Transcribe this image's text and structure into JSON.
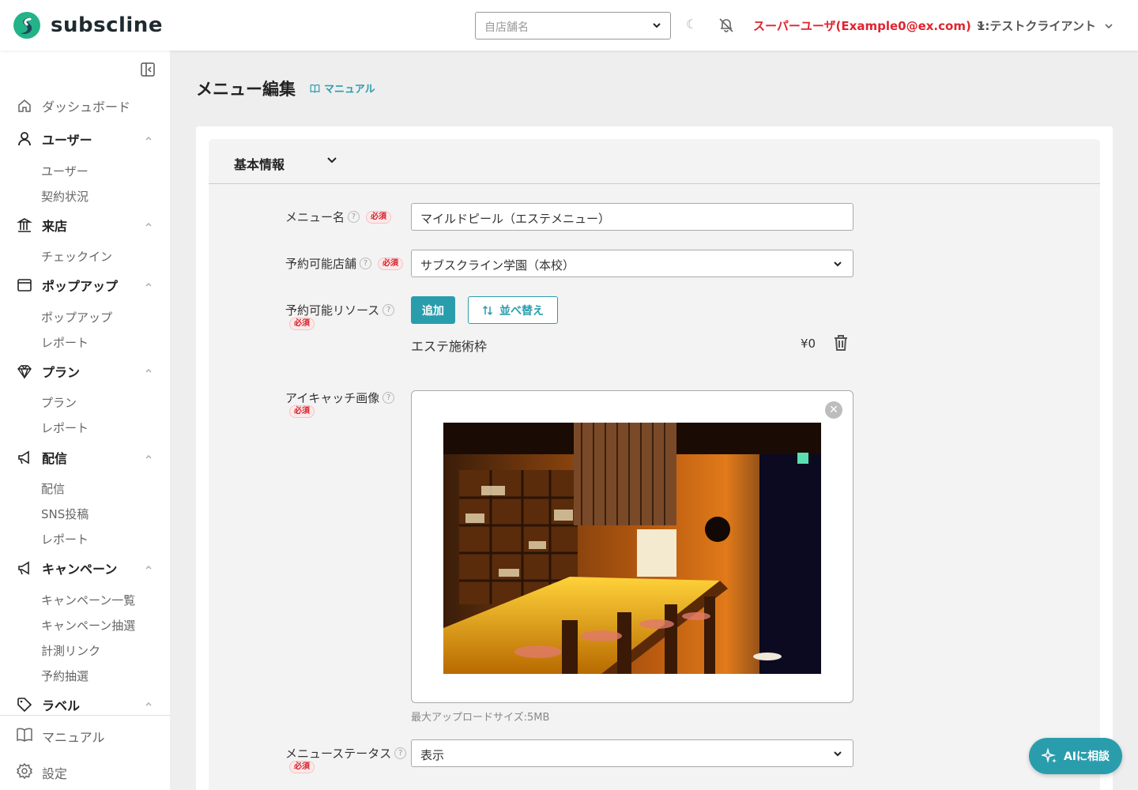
{
  "app": {
    "brand": "subscline",
    "accent": "#2a9dad",
    "alert": "#e0242f"
  },
  "header": {
    "store_placeholder": "自店舗名",
    "user_label": "スーパーユーザ(Example0@ex.com)",
    "client_label": "1:テストクライアント",
    "theme_icon": "moon-icon",
    "notify_icon": "bell-off-icon"
  },
  "sidebar": {
    "top_items": [
      {
        "label": "ダッシュボード",
        "icon": "home-icon"
      },
      {
        "label": "ユーザー",
        "icon": "user-icon",
        "sub": [
          "ユーザー",
          "契約状況"
        ]
      },
      {
        "label": "来店",
        "icon": "building-icon",
        "sub": [
          "チェックイン"
        ]
      },
      {
        "label": "ポップアップ",
        "icon": "window-icon",
        "sub": [
          "ポップアップ",
          "レポート"
        ]
      },
      {
        "label": "プラン",
        "icon": "diamond-icon",
        "sub": [
          "プラン",
          "レポート"
        ]
      },
      {
        "label": "配信",
        "icon": "megaphone-icon",
        "sub": [
          "配信",
          "SNS投稿",
          "レポート"
        ]
      },
      {
        "label": "キャンペーン",
        "icon": "megaphone-icon",
        "sub": [
          "キャンペーン一覧",
          "キャンペーン抽選",
          "計測リンク",
          "予約抽選"
        ]
      },
      {
        "label": "ラベル",
        "icon": "tag-icon"
      }
    ],
    "bottom_items": [
      {
        "label": "マニュアル",
        "icon": "book-icon"
      },
      {
        "label": "設定",
        "icon": "gear-icon"
      }
    ]
  },
  "page": {
    "title": "メニュー編集",
    "manual_link": "マニュアル",
    "section_title": "基本情報"
  },
  "form": {
    "required_badge": "必須",
    "help_mark": "?",
    "menu_name": {
      "label": "メニュー名",
      "value": "マイルドピール（エステメニュー）"
    },
    "store": {
      "label": "予約可能店舗",
      "value": "サブスクライン学園（本校）"
    },
    "resource": {
      "label": "予約可能リソース",
      "add_button": "追加",
      "sort_button": "並べ替え",
      "items": [
        {
          "name": "エステ施術枠",
          "price": "¥0"
        }
      ]
    },
    "eyecatch": {
      "label": "アイキャッチ画像",
      "close_mark": "✕",
      "hint": "最大アップロードサイズ:5MB"
    },
    "status": {
      "label": "メニューステータス",
      "value": "表示"
    }
  },
  "ai_button": {
    "label": "AIに相談"
  }
}
